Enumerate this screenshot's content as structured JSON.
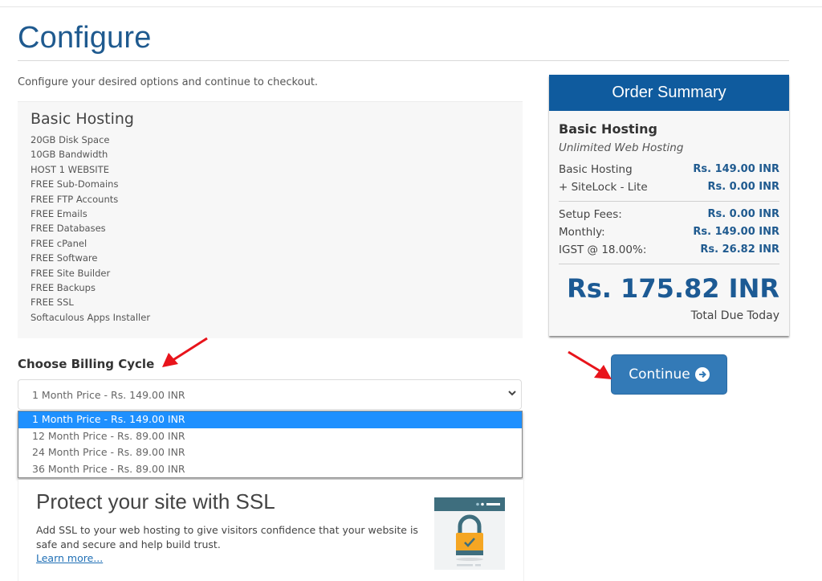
{
  "page": {
    "title": "Configure",
    "intro": "Configure your desired options and continue to checkout."
  },
  "product": {
    "name": "Basic Hosting",
    "features": [
      "20GB Disk Space",
      "10GB Bandwidth",
      "HOST 1 WEBSITE",
      "FREE Sub-Domains",
      "FREE FTP Accounts",
      "FREE Emails",
      "FREE Databases",
      "FREE cPanel",
      "FREE Software",
      "FREE Site Builder",
      "FREE Backups",
      "FREE SSL",
      "Softaculous Apps Installer"
    ]
  },
  "billing": {
    "label": "Choose Billing Cycle",
    "selected": "1 Month Price - Rs. 149.00 INR",
    "options": [
      "1 Month Price - Rs. 149.00 INR",
      "12 Month Price - Rs. 89.00 INR",
      "24 Month Price - Rs. 89.00 INR",
      "36 Month Price - Rs. 89.00 INR"
    ],
    "highlighted_index": 0
  },
  "ssl_promo": {
    "title": "Protect your site with SSL",
    "description": "Add SSL to your web hosting to give visitors confidence that your website is safe and secure and help build trust.",
    "link": "Learn more..."
  },
  "order_summary": {
    "heading": "Order Summary",
    "product": "Basic Hosting",
    "product_group": "Unlimited Web Hosting",
    "line_items": [
      {
        "label": "Basic Hosting",
        "value": "Rs. 149.00 INR"
      },
      {
        "label": "+ SiteLock - Lite",
        "value": "Rs. 0.00 INR"
      }
    ],
    "totals": [
      {
        "label": "Setup Fees:",
        "value": "Rs. 0.00 INR"
      },
      {
        "label": "Monthly:",
        "value": "Rs. 149.00 INR"
      },
      {
        "label": "IGST @ 18.00%:",
        "value": "Rs. 26.82 INR"
      }
    ],
    "total_due": "Rs. 175.82 INR",
    "total_label": "Total Due Today"
  },
  "actions": {
    "continue_label": "Continue"
  },
  "colors": {
    "brand": "#0f5b9e",
    "button": "#337ab7",
    "highlight": "#1e90ff",
    "annotation": "#e8141b"
  }
}
